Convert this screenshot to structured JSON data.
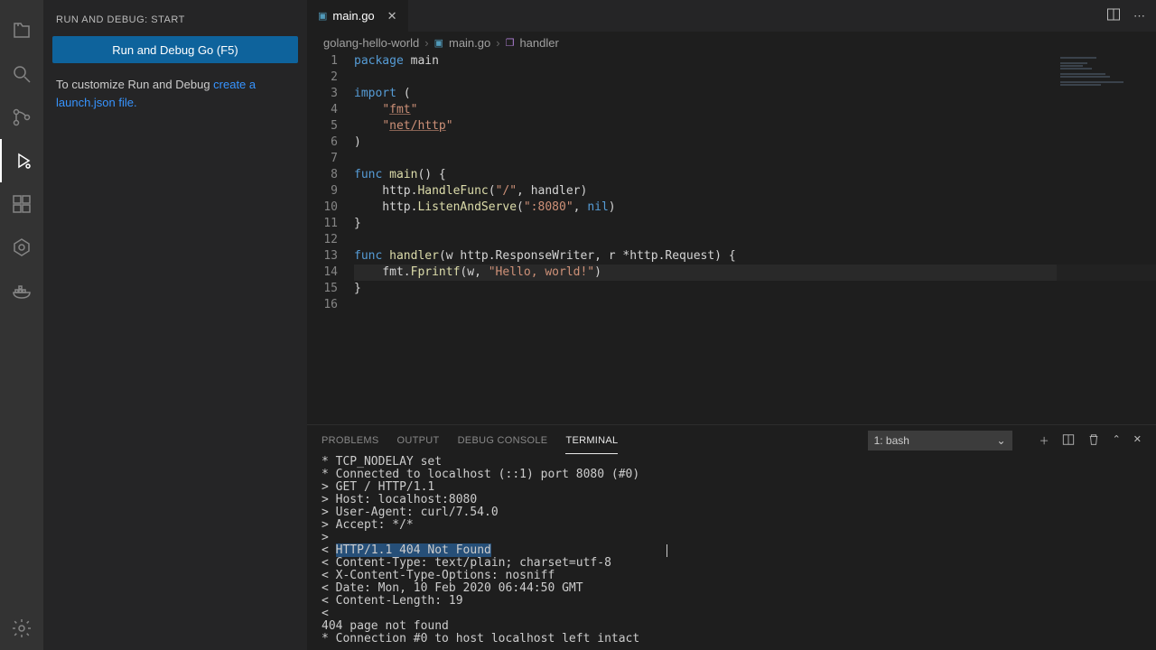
{
  "sidebar": {
    "title": "RUN AND DEBUG: START",
    "run_button": "Run and Debug Go (F5)",
    "customize_prefix": "To customize Run and Debug ",
    "customize_link": "create a launch.json file."
  },
  "tab": {
    "filename": "main.go"
  },
  "breadcrumb": {
    "project": "golang-hello-world",
    "file": "main.go",
    "symbol": "handler"
  },
  "code": {
    "lines": [
      [
        {
          "t": "package ",
          "c": "tok-kw"
        },
        {
          "t": "main",
          "c": ""
        }
      ],
      [],
      [
        {
          "t": "import ",
          "c": "tok-kw"
        },
        {
          "t": "(",
          "c": ""
        }
      ],
      [
        {
          "t": "    ",
          "c": ""
        },
        {
          "t": "\"",
          "c": "tok-str"
        },
        {
          "t": "fmt",
          "c": "tok-str tok-underline"
        },
        {
          "t": "\"",
          "c": "tok-str"
        }
      ],
      [
        {
          "t": "    ",
          "c": ""
        },
        {
          "t": "\"",
          "c": "tok-str"
        },
        {
          "t": "net/http",
          "c": "tok-str tok-underline"
        },
        {
          "t": "\"",
          "c": "tok-str"
        }
      ],
      [
        {
          "t": ")",
          "c": ""
        }
      ],
      [],
      [
        {
          "t": "func ",
          "c": "tok-kw"
        },
        {
          "t": "main",
          "c": "tok-func"
        },
        {
          "t": "() {",
          "c": ""
        }
      ],
      [
        {
          "t": "    http.",
          "c": ""
        },
        {
          "t": "HandleFunc",
          "c": "tok-func"
        },
        {
          "t": "(",
          "c": ""
        },
        {
          "t": "\"/\"",
          "c": "tok-str"
        },
        {
          "t": ", handler)",
          "c": ""
        }
      ],
      [
        {
          "t": "    http.",
          "c": ""
        },
        {
          "t": "ListenAndServe",
          "c": "tok-func"
        },
        {
          "t": "(",
          "c": ""
        },
        {
          "t": "\":8080\"",
          "c": "tok-str"
        },
        {
          "t": ", ",
          "c": ""
        },
        {
          "t": "nil",
          "c": "tok-const"
        },
        {
          "t": ")",
          "c": ""
        }
      ],
      [
        {
          "t": "}",
          "c": ""
        }
      ],
      [],
      [
        {
          "t": "func ",
          "c": "tok-kw"
        },
        {
          "t": "handler",
          "c": "tok-func"
        },
        {
          "t": "(w http.ResponseWriter, r *http.Request) {",
          "c": ""
        }
      ],
      [
        {
          "t": "    fmt.",
          "c": ""
        },
        {
          "t": "Fprintf",
          "c": "tok-func"
        },
        {
          "t": "(w, ",
          "c": ""
        },
        {
          "t": "\"Hello, world!\"",
          "c": "tok-str"
        },
        {
          "t": ")",
          "c": ""
        }
      ],
      [
        {
          "t": "}",
          "c": ""
        }
      ],
      []
    ],
    "line_count": 16,
    "highlight_line": 14
  },
  "panel": {
    "tabs": [
      "PROBLEMS",
      "OUTPUT",
      "DEBUG CONSOLE",
      "TERMINAL"
    ],
    "active_tab": 3,
    "terminal_name": "1: bash"
  },
  "terminal": {
    "lines": [
      "* TCP_NODELAY set",
      "* Connected to localhost (::1) port 8080 (#0)",
      "> GET / HTTP/1.1",
      "> Host: localhost:8080",
      "> User-Agent: curl/7.54.0",
      "> Accept: */*",
      ">",
      "< HTTP/1.1 404 Not Found",
      "< Content-Type: text/plain; charset=utf-8",
      "< X-Content-Type-Options: nosniff",
      "< Date: Mon, 10 Feb 2020 06:44:50 GMT",
      "< Content-Length: 19",
      "<",
      "404 page not found",
      "* Connection #0 to host localhost left intact"
    ],
    "highlight_line_index": 7,
    "highlight_prefix": "< ",
    "highlight_text": "HTTP/1.1 404 Not Found"
  }
}
